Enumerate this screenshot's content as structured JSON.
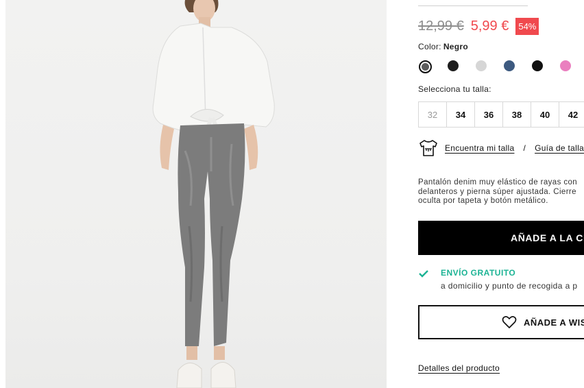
{
  "product": {
    "old_price": "12,99 €",
    "new_price": "5,99 €",
    "discount": "54%",
    "color_label": "Color:",
    "color_value": "Negro",
    "swatches": [
      {
        "name": "acid-grey",
        "color": "#5c5c5c",
        "selected": true
      },
      {
        "name": "black",
        "color": "#1d1d1d"
      },
      {
        "name": "light-grey",
        "color": "#d6d6d6"
      },
      {
        "name": "denim-blue",
        "color": "#3d5a80"
      },
      {
        "name": "black-2",
        "color": "#111111"
      },
      {
        "name": "pink",
        "color": "#ea7fbf"
      }
    ],
    "size_label": "Selecciona tu talla:",
    "sizes": [
      "32",
      "34",
      "36",
      "38",
      "40",
      "42"
    ],
    "find_size": "Encuentra mi talla",
    "separator": "/",
    "size_guide": "Guía de talla",
    "description": "Pantalón denim muy elástico de rayas con\ndelanteros y pierna súper ajustada. Cierre\noculta por tapeta y botón metálico.",
    "add_to_cart": "AÑADE A LA CE",
    "shipping_title": "ENVÍO GRATUITO",
    "shipping_sub": "a domicilio y punto de recogida a p",
    "wishlist": "AÑADE A WISH",
    "details": "Detalles del producto"
  },
  "icons": {
    "size_icon": "tshirt-ruler-icon",
    "check_icon": "check-icon",
    "heart_icon": "heart-icon"
  },
  "colors": {
    "sale": "#f0494e",
    "shipping": "#1bb394",
    "button": "#000000"
  }
}
